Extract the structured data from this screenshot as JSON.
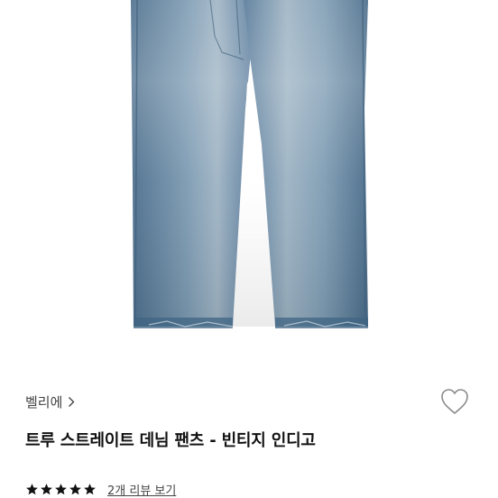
{
  "product": {
    "image_subject": "jeans-photo",
    "brand": "벨리에",
    "name": "트루 스트레이트 데님 팬츠 - 빈티지 인디고",
    "rating": 5,
    "rating_max": 5,
    "review_link": "2개 리뷰 보기"
  },
  "icons": {
    "brand_chevron": "chevron-right-icon",
    "like": "heart-outline-icon",
    "star": "star-icon"
  },
  "colors": {
    "denim_dark": "#4b6e8c",
    "denim_mid": "#6f8faa",
    "denim_light": "#a8bccb",
    "star": "#111111"
  }
}
